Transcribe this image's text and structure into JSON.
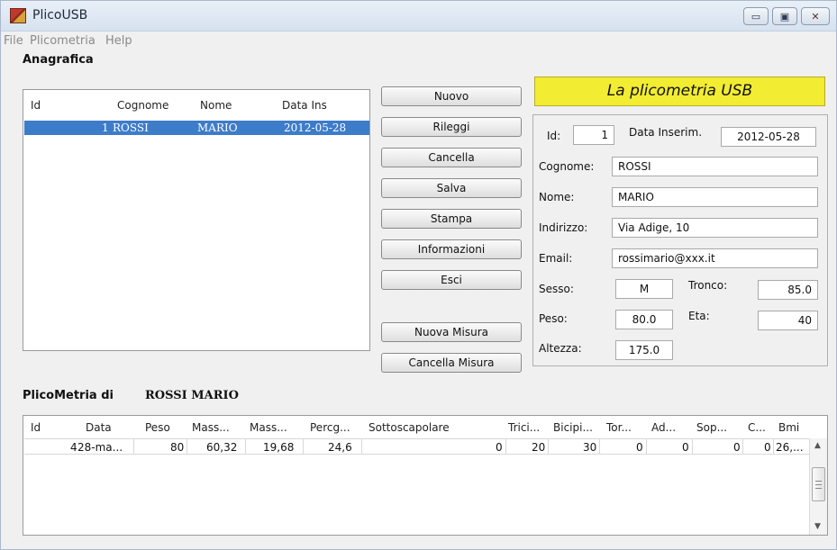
{
  "window": {
    "title": "PlicoUSB",
    "controls": {
      "minimize": "▭",
      "maximize": "▣",
      "close": "✕"
    }
  },
  "menu": [
    "File",
    "Plicometria",
    "Help"
  ],
  "anagrafica": {
    "title": "Anagrafica",
    "columns": [
      "Id",
      "Cognome",
      "Nome",
      "Data Ins"
    ],
    "rows": [
      {
        "id": "1",
        "cognome": "ROSSI",
        "nome": "MARIO",
        "data_ins": "2012-05-28"
      }
    ]
  },
  "buttons": {
    "nuovo": "Nuovo",
    "rileggi": "Rileggi",
    "cancella": "Cancella",
    "salva": "Salva",
    "stampa": "Stampa",
    "informazioni": "Informazioni",
    "esci": "Esci",
    "nuova_misura": "Nuova Misura",
    "cancella_misura": "Cancella Misura"
  },
  "detail": {
    "banner": "La plicometria USB",
    "id_label": "Id:",
    "id_value": "1",
    "data_label": "Data Inserim.",
    "data_value": "2012-05-28",
    "cognome_label": "Cognome:",
    "cognome_value": "ROSSI",
    "nome_label": "Nome:",
    "nome_value": "MARIO",
    "indirizzo_label": "Indirizzo:",
    "indirizzo_value": "Via Adige, 10",
    "email_label": "Email:",
    "email_value": "rossimario@xxx.it",
    "sesso_label": "Sesso:",
    "sesso_value": "M",
    "tronco_label": "Tronco:",
    "tronco_value": "85.0",
    "peso_label": "Peso:",
    "peso_value": "80.0",
    "eta_label": "Eta:",
    "eta_value": "40",
    "altezza_label": "Altezza:",
    "altezza_value": "175.0"
  },
  "plicometria": {
    "title_prefix": "PlicoMetria di",
    "person": "ROSSI MARIO",
    "columns": [
      "Id",
      "Data",
      "Peso",
      "Mass...",
      "Mass...",
      "Percg...",
      "Sottoscapolare",
      "Trici...",
      "Bicipi...",
      "Tor...",
      "Ad...",
      "Sop...",
      "C...",
      "Bmi"
    ],
    "row": [
      "4",
      "28-ma...",
      "80",
      "60,32",
      "19,68",
      "24,6",
      "0",
      "20",
      "30",
      "0",
      "0",
      "0",
      "0",
      "26,..."
    ],
    "scroll": {
      "up": "▲",
      "down": "▼"
    }
  }
}
